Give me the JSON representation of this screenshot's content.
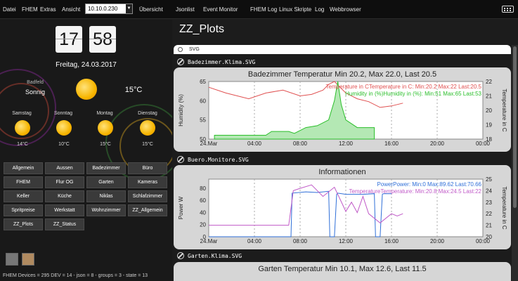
{
  "menu": {
    "items": [
      {
        "label": "Datei"
      },
      {
        "label": "FHEM"
      },
      {
        "label": "Extras"
      },
      {
        "label": "Ansicht"
      },
      {
        "label": "Übersicht"
      },
      {
        "label": "Jsonlist"
      },
      {
        "label": "Event Monitor"
      },
      {
        "label": "FHEM Log"
      },
      {
        "label": "Linux Skripte"
      },
      {
        "label": "Log"
      },
      {
        "label": "Webbrowser"
      }
    ],
    "host_select": "10.10.0.230",
    "keyboard_icon": "keyboard-icon"
  },
  "clock": {
    "hour": "17",
    "minute": "58"
  },
  "date": "Freitag, 24.03.2017",
  "weather": {
    "location": "Badfeld",
    "today": {
      "condition": "Sonnig",
      "temp": "15°C",
      "icon": "sun-icon"
    },
    "forecast": [
      {
        "day": "Samstag",
        "temp": "14°C",
        "icon": "sun-icon"
      },
      {
        "day": "Sonntag",
        "temp": "10°C",
        "icon": "sun-icon"
      },
      {
        "day": "Montag",
        "temp": "15°C",
        "icon": "sun-icon"
      },
      {
        "day": "Dienstag",
        "temp": "15°C",
        "icon": "sun-icon"
      }
    ]
  },
  "rooms": [
    "Allgemein",
    "Aussen",
    "Badezimmer",
    "Büro",
    "FHEM",
    "Flur OG",
    "Garten",
    "Kameras",
    "Keller",
    "Küche",
    "Niklas",
    "Schlafzimmer",
    "Spritpreise",
    "Werkstatt",
    "Wohnzimmer",
    "ZZ_Allgemein",
    "ZZ_Plots",
    "ZZ_Status"
  ],
  "status_line": "FHEM Devices = 295  DEV = 14 - json = 8 - groups = 3 - state = 13",
  "page": {
    "title": "ZZ_Plots",
    "table_header": "SVG"
  },
  "devices": [
    {
      "name": "Badezimmer.Klima.SVG"
    },
    {
      "name": "Buero.Monitore.SVG"
    },
    {
      "name": "Garten.Klima.SVG"
    }
  ],
  "colors": {
    "humidity": "#2bbf2b",
    "humidity_fill": "#b4e8b4",
    "temperature": "#e05050",
    "power": "#2f6fd8",
    "temperature2": "#c05ac8"
  },
  "chart_data": [
    {
      "type": "line",
      "title": "Badezimmer Temperatur Min 20.2, Max 22.0, Last 20.5",
      "ylabel": "Humidity (%)",
      "ylabel_right": "Temperature in C",
      "x_ticks": [
        "24.Mar",
        "04:00",
        "08:00",
        "12:00",
        "16:00",
        "20:00",
        "00:00"
      ],
      "y_ticks": [
        "50",
        "55",
        "60",
        "65"
      ],
      "y2_ticks": [
        "18",
        "19",
        "20",
        "21",
        "22"
      ],
      "ylim": [
        50,
        65
      ],
      "y2lim": [
        18,
        22
      ],
      "legend": [
        "Temperature in CTemperature in C: Min:20.2 Max:22 Last:20.5",
        "Humidity in (%)Humidity in (%): Min:51 Max:65 Last:53"
      ],
      "series": [
        {
          "name": "Temperature in C",
          "axis": "y2",
          "x": [
            0.0,
            1.5,
            3.5,
            5.0,
            6.5,
            8.0,
            9.0,
            10.0,
            10.5,
            11.0,
            11.5,
            12.0,
            13.0,
            14.0,
            15.0,
            16.0,
            17.0
          ],
          "values": [
            21.6,
            21.2,
            20.8,
            21.2,
            21.4,
            21.0,
            21.1,
            21.4,
            21.8,
            22.0,
            21.6,
            21.2,
            20.8,
            20.6,
            20.2,
            20.3,
            20.5
          ]
        },
        {
          "name": "Humidity in (%)",
          "axis": "y",
          "x": [
            0.5,
            5.0,
            5.5,
            7.0,
            7.5,
            8.5,
            9.5,
            10.5,
            11.0,
            11.3,
            11.6,
            12.0,
            12.5,
            13.0,
            14.5
          ],
          "values": [
            51,
            51,
            52,
            52,
            51.5,
            53,
            53.5,
            55,
            60,
            65,
            59,
            55,
            54,
            53,
            53
          ]
        }
      ]
    },
    {
      "type": "line",
      "title": "Informationen",
      "ylabel": "Power W",
      "ylabel_right": "Temperature in C",
      "x_ticks": [
        "24.Mar",
        "04:00",
        "08:00",
        "12:00",
        "16:00",
        "20:00",
        "00:00"
      ],
      "y_ticks": [
        "0",
        "20",
        "40",
        "60",
        "80"
      ],
      "y2_ticks": [
        "20",
        "21",
        "22",
        "23",
        "24",
        "25"
      ],
      "ylim": [
        0,
        95
      ],
      "y2lim": [
        20,
        25
      ],
      "legend": [
        "PowerPower: Min:0 Max:89.62 Last:70.66",
        "TemperatureTemperature: Min:20.8 Max:24.5 Last:22"
      ],
      "series": [
        {
          "name": "Power",
          "axis": "y",
          "x": [
            0.0,
            7.2,
            7.3,
            8.5,
            9.5,
            10.5,
            10.6,
            11.0,
            11.2,
            11.3,
            12.0,
            13.5,
            14.5,
            14.6,
            15.0,
            15.2,
            15.3,
            16.0
          ],
          "values": [
            0,
            0,
            72,
            74,
            73,
            75,
            0,
            0,
            70,
            72,
            70,
            70,
            71,
            0,
            0,
            70,
            71,
            71
          ]
        },
        {
          "name": "Temperature",
          "axis": "y2",
          "x": [
            0.0,
            7.0,
            7.4,
            8.0,
            9.0,
            10.0,
            11.0,
            12.0,
            12.5,
            13.0,
            13.5,
            14.0,
            15.0,
            16.0,
            16.5,
            17.0
          ],
          "values": [
            21.0,
            21.0,
            24.0,
            24.2,
            24.5,
            23.5,
            24.3,
            22.2,
            23.0,
            22.1,
            23.5,
            22.0,
            21.2,
            22.0,
            21.8,
            22.0
          ]
        }
      ]
    },
    {
      "type": "line",
      "title": "Garten Temperatur Min 10.1, Max 12.6, Last 11.5"
    }
  ]
}
